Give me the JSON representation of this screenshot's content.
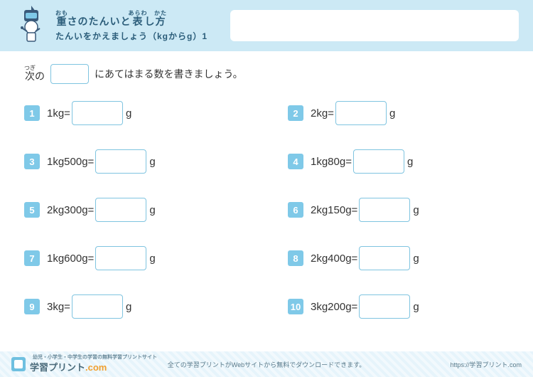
{
  "header": {
    "title_html": "<ruby>重<rt>おも</rt></ruby>さのたんいと<ruby>表<rt>あらわ</rt></ruby>し<ruby>方<rt>かた</rt></ruby>",
    "subtitle": "たんいをかえましょう（kgからg）1"
  },
  "instruction": {
    "prefix_html": "<ruby>次<rt>つぎ</rt></ruby>の",
    "suffix": "にあてはまる数を書きましょう。"
  },
  "problems": [
    {
      "n": "1",
      "left": "1kg=",
      "unit": "g"
    },
    {
      "n": "2",
      "left": "2kg=",
      "unit": "g"
    },
    {
      "n": "3",
      "left": "1kg500g=",
      "unit": "g"
    },
    {
      "n": "4",
      "left": "1kg80g=",
      "unit": "g"
    },
    {
      "n": "5",
      "left": "2kg300g=",
      "unit": "g"
    },
    {
      "n": "6",
      "left": "2kg150g=",
      "unit": "g"
    },
    {
      "n": "7",
      "left": "1kg600g=",
      "unit": "g"
    },
    {
      "n": "8",
      "left": "2kg400g=",
      "unit": "g"
    },
    {
      "n": "9",
      "left": "3kg=",
      "unit": "g"
    },
    {
      "n": "10",
      "left": "3kg200g=",
      "unit": "g"
    }
  ],
  "footer": {
    "tagline": "幼児・小学生・中学生の学習の無料学習プリントサイト",
    "brand": "学習プリント",
    "brand_suffix": ".com",
    "center": "全ての学習プリントがWebサイトから無料でダウンロードできます。",
    "url": "https://学習プリント.com"
  }
}
